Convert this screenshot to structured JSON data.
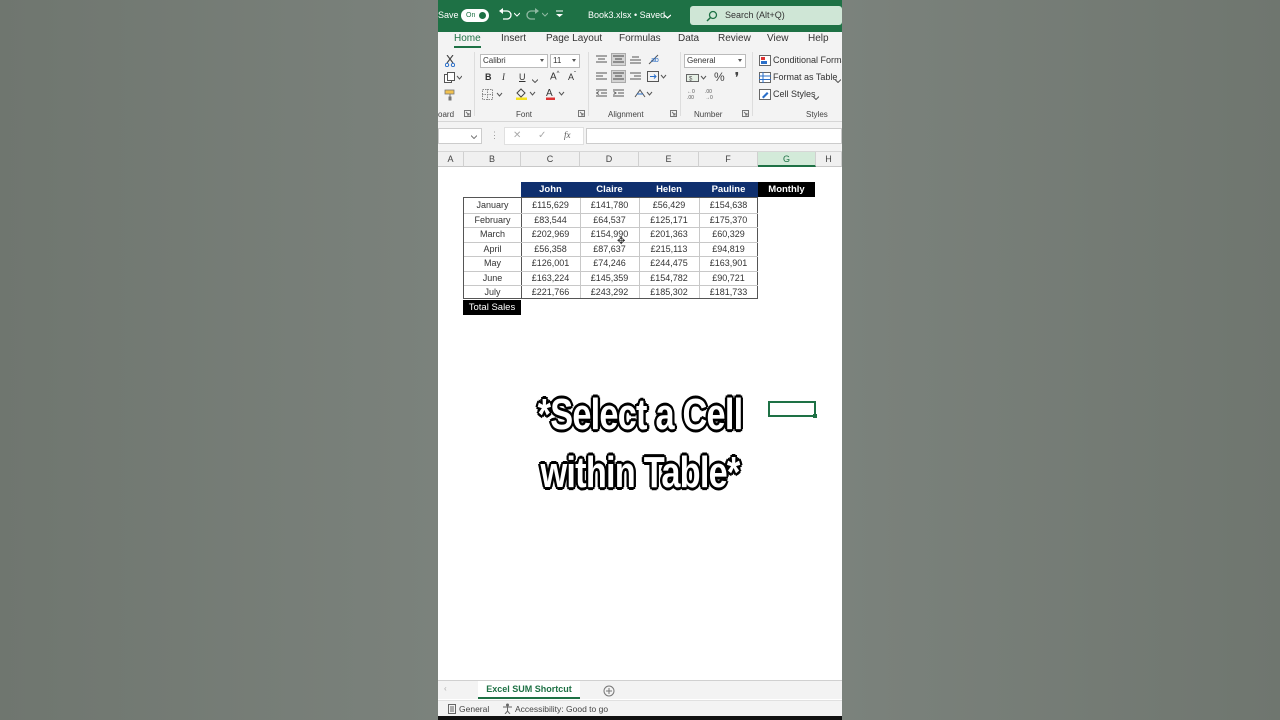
{
  "titlebar": {
    "autosave_label": "Save",
    "toggle_label": "On",
    "filename": "Book3.xlsx • Saved",
    "search_placeholder": "Search (Alt+Q)"
  },
  "tabs": [
    "Home",
    "Insert",
    "Page Layout",
    "Formulas",
    "Data",
    "Review",
    "View",
    "Help"
  ],
  "ribbon": {
    "font_name": "Calibri",
    "font_size": "11",
    "number_format": "General",
    "bold": "B",
    "italic": "I",
    "underline": "U",
    "conditional_formatting": "Conditional Forma",
    "format_as_table": "Format as Table",
    "cell_styles": "Cell Styles",
    "groups": {
      "clipboard": "oard",
      "font": "Font",
      "alignment": "Alignment",
      "number": "Number",
      "styles": "Styles"
    }
  },
  "formula_bar": {
    "fx": "fx"
  },
  "columns": [
    "A",
    "B",
    "C",
    "D",
    "E",
    "F",
    "G",
    "H"
  ],
  "table": {
    "headers": [
      "John",
      "Claire",
      "Helen",
      "Pauline",
      "Monthly"
    ],
    "rows": [
      {
        "month": "January",
        "values": [
          "£115,629",
          "£141,780",
          "£56,429",
          "£154,638"
        ]
      },
      {
        "month": "February",
        "values": [
          "£83,544",
          "£64,537",
          "£125,171",
          "£175,370"
        ]
      },
      {
        "month": "March",
        "values": [
          "£202,969",
          "£154,990",
          "£201,363",
          "£60,329"
        ]
      },
      {
        "month": "April",
        "values": [
          "£56,358",
          "£87,637",
          "£215,113",
          "£94,819"
        ]
      },
      {
        "month": "May",
        "values": [
          "£126,001",
          "£74,246",
          "£244,475",
          "£163,901"
        ]
      },
      {
        "month": "June",
        "values": [
          "£163,224",
          "£145,359",
          "£154,782",
          "£90,721"
        ]
      },
      {
        "month": "July",
        "values": [
          "£221,766",
          "£243,292",
          "£185,302",
          "£181,733"
        ]
      }
    ],
    "total_label": "Total Sales"
  },
  "overlay": {
    "line1": "*Select a Cell",
    "line2": "within Table*"
  },
  "sheet_tab": "Excel SUM Shortcut",
  "status": {
    "mode": "General",
    "accessibility": "Accessibility: Good to go"
  },
  "colors": {
    "excel_green": "#1e7145",
    "header_navy": "#0f2f6e",
    "monthly_black": "#000000"
  }
}
